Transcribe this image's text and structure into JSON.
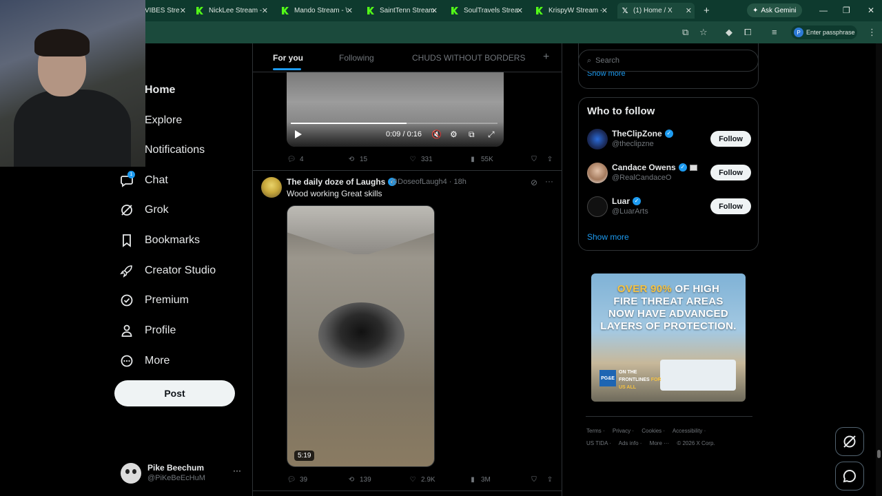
{
  "browser": {
    "tabs": [
      {
        "label": "VIBES Stre",
        "kind": "kick"
      },
      {
        "label": "NickLee Stream -",
        "kind": "kick"
      },
      {
        "label": "Mando Stream - \\",
        "kind": "kick"
      },
      {
        "label": "SaintTenn Stream",
        "kind": "kick"
      },
      {
        "label": "SoulTravels Strea",
        "kind": "kick"
      },
      {
        "label": "KrispyW Stream -",
        "kind": "kick"
      },
      {
        "label": "(1) Home / X",
        "kind": "x",
        "active": true
      }
    ],
    "gemini_label": "Ask Gemini",
    "passphrase_label": "Enter passphrase",
    "profile_initial": "P"
  },
  "nav": {
    "items": [
      {
        "label": "Home",
        "icon": "home-icon"
      },
      {
        "label": "Explore",
        "icon": "search-icon"
      },
      {
        "label": "Notifications",
        "icon": "bell-icon"
      },
      {
        "label": "Chat",
        "icon": "chat-icon",
        "badge": "1"
      },
      {
        "label": "Grok",
        "icon": "grok-icon"
      },
      {
        "label": "Bookmarks",
        "icon": "bookmark-icon"
      },
      {
        "label": "Creator Studio",
        "icon": "rocket-icon"
      },
      {
        "label": "Premium",
        "icon": "premium-icon"
      },
      {
        "label": "Profile",
        "icon": "person-icon"
      },
      {
        "label": "More",
        "icon": "more-circle-icon"
      }
    ],
    "post_label": "Post"
  },
  "account": {
    "name": "Pike Beechum",
    "handle": "@PiKeBeEcHuM",
    "menu": "···"
  },
  "feed": {
    "tabs": [
      "For you",
      "Following",
      "CHUDS WITHOUT BORDERS"
    ],
    "add_tab": "+",
    "post1": {
      "video_time": "0:09 / 0:16",
      "replies": "4",
      "reposts": "15",
      "likes": "331",
      "views": "55K"
    },
    "post2": {
      "name": "The daily doze of Laughs",
      "handle": "@DoseofLaugh4 · 18h",
      "text": "Wood working Great skills",
      "duration": "5:19",
      "replies": "39",
      "reposts": "139",
      "likes": "2.9K",
      "views": "3M"
    }
  },
  "sidebar": {
    "search_placeholder": "Search",
    "trends_show_more": "Show more",
    "who_to_follow_title": "Who to follow",
    "follow_label": "Follow",
    "who": [
      {
        "name": "TheClipZone",
        "handle": "@theclipzne"
      },
      {
        "name": "Candace Owens",
        "handle": "@RealCandaceO"
      },
      {
        "name": "Luar",
        "handle": "@LuarArts"
      }
    ],
    "who_show_more": "Show more",
    "ad": {
      "line1_highlight": "OVER 90%",
      "line1_rest": " OF HIGH",
      "line2": "FIRE THREAT AREAS",
      "line3": "NOW HAVE ADVANCED",
      "line4": "LAYERS OF PROTECTION.",
      "logo": "PG&E",
      "tag1": "ON THE",
      "tag2": "FRONTLINES",
      "tag3": "FOR",
      "tag4": "US ALL"
    },
    "footer": {
      "row1": [
        "Terms ·",
        "Privacy ·",
        "Cookies ·",
        "Accessibility ·"
      ],
      "row2": [
        "US TIDA ·",
        "Ads info ·",
        "More ···",
        "© 2026 X Corp."
      ]
    }
  }
}
